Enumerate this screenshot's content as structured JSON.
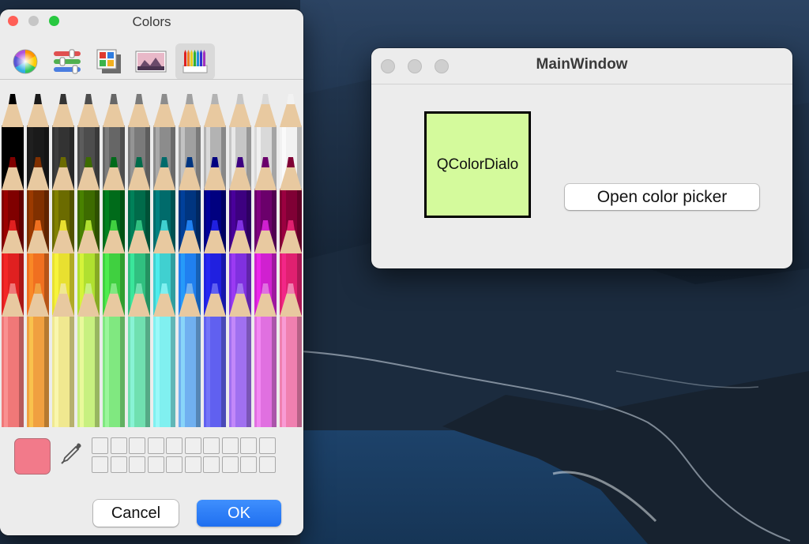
{
  "colors_panel": {
    "title": "Colors",
    "traffic_colors": [
      "#ff5f57",
      "#c6c6c6",
      "#28c840"
    ],
    "toolbar_icons": [
      "color-wheel-icon",
      "color-sliders-icon",
      "color-palettes-icon",
      "image-palettes-icon",
      "pencils-icon"
    ],
    "active_tab": "pencils-icon",
    "pencil_colors": [
      [
        "#000000",
        "#1a1a1a",
        "#333333",
        "#4d4d4d",
        "#666666",
        "#7a7a7a",
        "#8c8c8c",
        "#a0a0a0",
        "#b3b3b3",
        "#c6c6c6",
        "#d9d9d9",
        "#f2f2f2"
      ],
      [
        "#800000",
        "#803000",
        "#6b6b00",
        "#3d6b00",
        "#006b1a",
        "#006b4a",
        "#006b6b",
        "#003580",
        "#000080",
        "#3d0080",
        "#6b006b",
        "#800035"
      ],
      [
        "#e02020",
        "#f07020",
        "#e8e030",
        "#b0e030",
        "#40d040",
        "#30c080",
        "#40d0d0",
        "#2080f0",
        "#2020e0",
        "#8030e0",
        "#d020d0",
        "#e02070"
      ],
      [
        "#f07878",
        "#f0a040",
        "#f0e890",
        "#c8f080",
        "#80e880",
        "#70e0b0",
        "#80f0f0",
        "#70b0f0",
        "#6060f0",
        "#a070f0",
        "#e070e0",
        "#f080b0"
      ]
    ],
    "current_color": "#f27a8a",
    "cancel_label": "Cancel",
    "ok_label": "OK"
  },
  "main_window": {
    "title": "MainWindow",
    "traffic_colors": [
      "#cfcfcf",
      "#cfcfcf",
      "#cfcfcf"
    ],
    "color_box_label": "QColorDialo",
    "color_box_fill": "#d4fa9c",
    "open_button_label": "Open color picker"
  }
}
